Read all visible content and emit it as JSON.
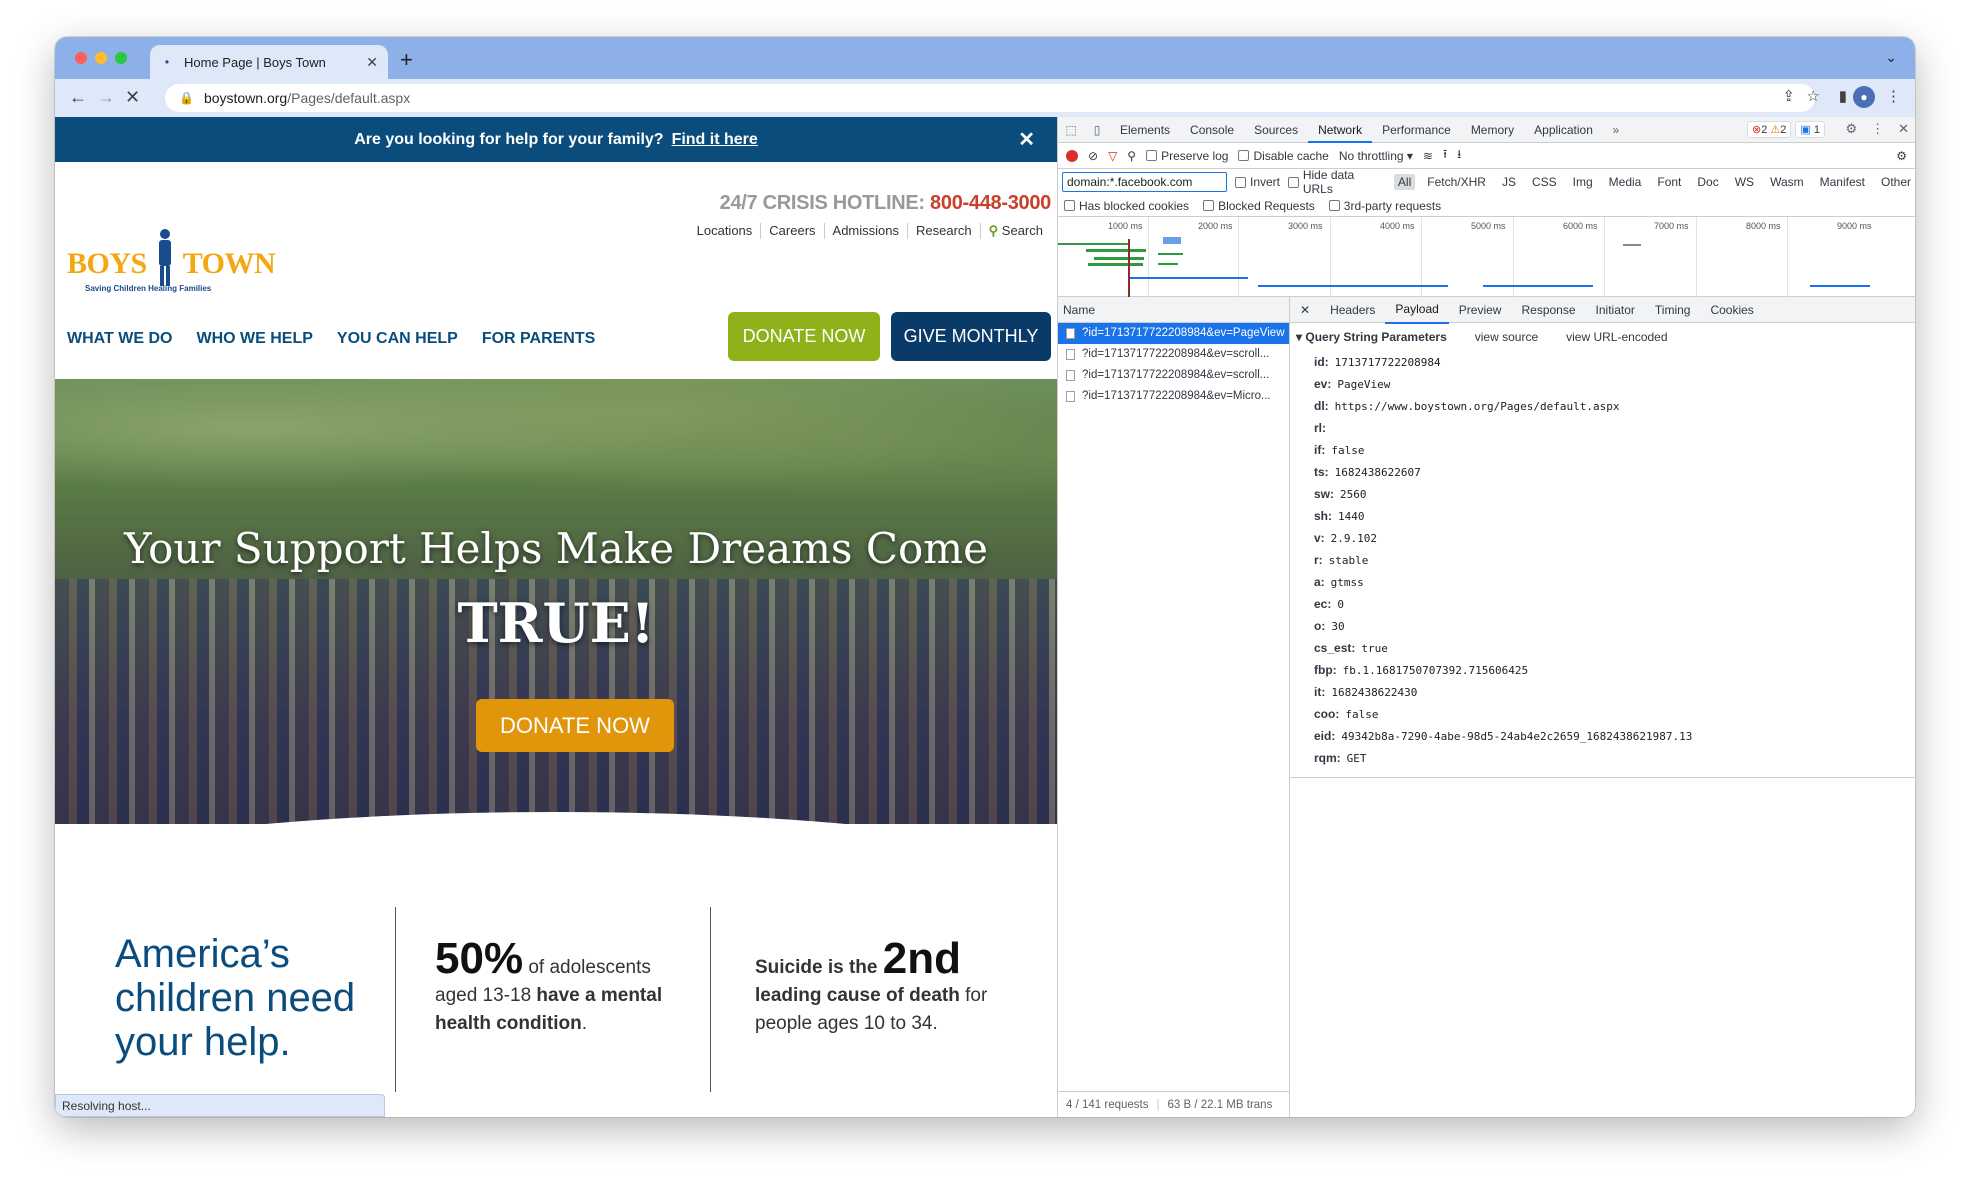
{
  "browser": {
    "tab_title": "Home Page | Boys Town",
    "url_host": "boystown.org",
    "url_path": "/Pages/default.aspx",
    "status_text": "Resolving host..."
  },
  "site": {
    "promo_text": "Are you looking for help for your family?",
    "promo_link": "Find it here",
    "logo_left": "BOYS",
    "logo_right": "TOWN",
    "logo_tagline": "Saving Children    Healing Families",
    "hotline_label": "24/7 CRISIS HOTLINE:",
    "hotline_number": "800-448-3000",
    "utility_links": [
      "Locations",
      "Careers",
      "Admissions",
      "Research",
      "Search"
    ],
    "nav": [
      "WHAT WE DO",
      "WHO WE HELP",
      "YOU CAN HELP",
      "FOR PARENTS"
    ],
    "donate_label": "DONATE NOW",
    "monthly_label": "GIVE MONTHLY",
    "hero_title": "Your Support Helps Make Dreams Come",
    "hero_true": "TRUE!",
    "hero_donate": "DONATE NOW",
    "stat1": "America’s children need your help.",
    "stat2_big": "50%",
    "stat2_a": " of adolescents aged 13-18 ",
    "stat2_b": "have a mental health condition",
    "stat2_c": ".",
    "stat3_a": "Suicide is the ",
    "stat3_big": "2nd",
    "stat3_b": "leading cause of death",
    "stat3_c": " for people ages 10 to 34."
  },
  "devtools": {
    "tabs": [
      "Elements",
      "Console",
      "Sources",
      "Network",
      "Performance",
      "Memory",
      "Application"
    ],
    "active_tab": "Network",
    "badge_errors": "2",
    "badge_warnings": "2",
    "badge_info": "1",
    "preserve_log": "Preserve log",
    "disable_cache": "Disable cache",
    "throttling": "No throttling",
    "filter_value": "domain:*.facebook.com",
    "invert": "Invert",
    "hide_data_urls": "Hide data URLs",
    "filter_types": [
      "All",
      "Fetch/XHR",
      "JS",
      "CSS",
      "Img",
      "Media",
      "Font",
      "Doc",
      "WS",
      "Wasm",
      "Manifest",
      "Other"
    ],
    "has_blocked_cookies": "Has blocked cookies",
    "blocked_requests": "Blocked Requests",
    "third_party": "3rd-party requests",
    "timeline_ticks": [
      "1000 ms",
      "2000 ms",
      "3000 ms",
      "4000 ms",
      "5000 ms",
      "6000 ms",
      "7000 ms",
      "8000 ms",
      "9000 ms"
    ],
    "name_header": "Name",
    "requests": [
      "?id=1713717722208984&ev=PageView",
      "?id=1713717722208984&ev=scroll...",
      "?id=1713717722208984&ev=scroll...",
      "?id=1713717722208984&ev=Micro..."
    ],
    "summary_requests": "4 / 141 requests",
    "summary_transfer": "63 B / 22.1 MB trans",
    "detail_tabs": [
      "Headers",
      "Payload",
      "Preview",
      "Response",
      "Initiator",
      "Timing",
      "Cookies"
    ],
    "active_detail_tab": "Payload",
    "qs_title": "Query String Parameters",
    "view_source": "view source",
    "view_url_encoded": "view URL-encoded",
    "params": [
      {
        "k": "id:",
        "v": "1713717722208984"
      },
      {
        "k": "ev:",
        "v": "PageView"
      },
      {
        "k": "dl:",
        "v": "https://www.boystown.org/Pages/default.aspx"
      },
      {
        "k": "rl:",
        "v": ""
      },
      {
        "k": "if:",
        "v": "false"
      },
      {
        "k": "ts:",
        "v": "1682438622607"
      },
      {
        "k": "sw:",
        "v": "2560"
      },
      {
        "k": "sh:",
        "v": "1440"
      },
      {
        "k": "v:",
        "v": "2.9.102"
      },
      {
        "k": "r:",
        "v": "stable"
      },
      {
        "k": "a:",
        "v": "gtmss"
      },
      {
        "k": "ec:",
        "v": "0"
      },
      {
        "k": "o:",
        "v": "30"
      },
      {
        "k": "cs_est:",
        "v": "true"
      },
      {
        "k": "fbp:",
        "v": "fb.1.1681750707392.715606425"
      },
      {
        "k": "it:",
        "v": "1682438622430"
      },
      {
        "k": "coo:",
        "v": "false"
      },
      {
        "k": "eid:",
        "v": "49342b8a-7290-4abe-98d5-24ab4e2c2659_1682438621987.13"
      },
      {
        "k": "rqm:",
        "v": "GET"
      }
    ]
  }
}
